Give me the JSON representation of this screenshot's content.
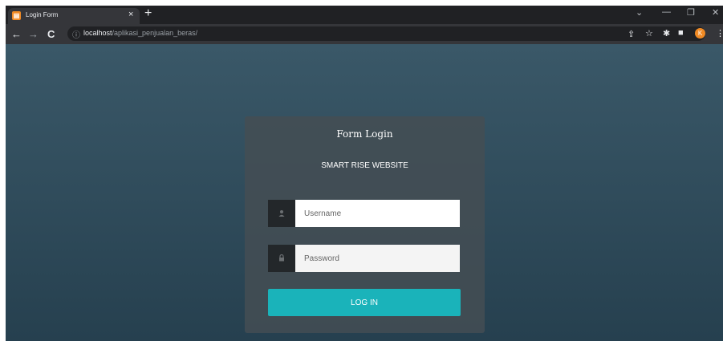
{
  "browser": {
    "tab_title": "Login Form",
    "tab_icon": "document-icon",
    "tab_close": "×",
    "new_tab": "+",
    "url_host": "localhost",
    "url_path": "/aplikasi_penjualan_beras/",
    "profile_initial": "K",
    "colors": {
      "frame": "#202124",
      "toolbar": "#35363a",
      "profile": "#f08a24"
    }
  },
  "login": {
    "title": "Form Login",
    "subtitle": "SMART RISE WEBSITE",
    "username_placeholder": "Username",
    "password_placeholder": "Password",
    "button_label": "LOG IN",
    "colors": {
      "button": "#1ab3ba",
      "background_top": "#3a5868",
      "background_bottom": "#26404f"
    }
  }
}
